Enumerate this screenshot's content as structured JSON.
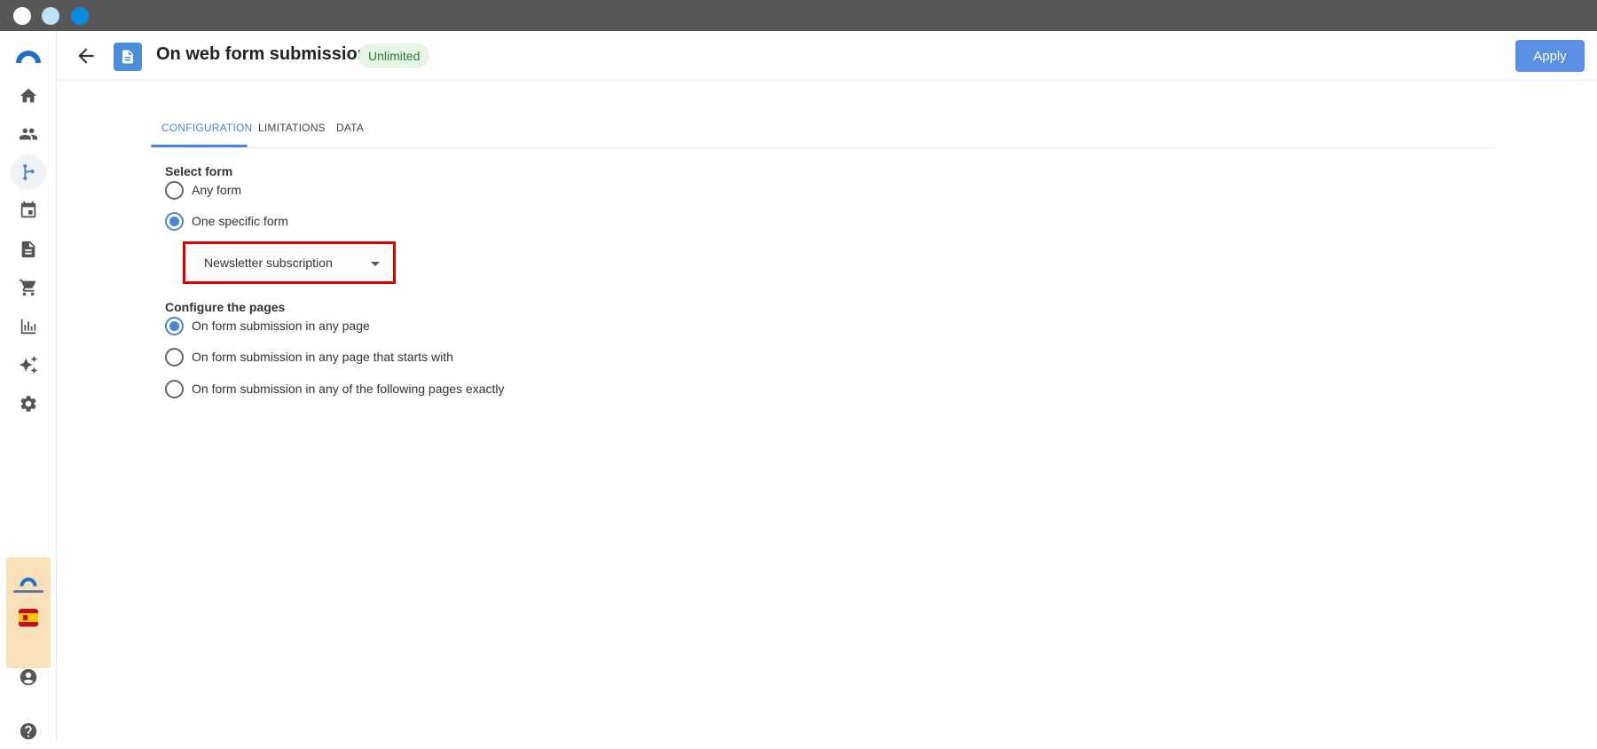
{
  "header": {
    "title": "On web form submission",
    "status_badge": "Unlimited",
    "apply_label": "Apply"
  },
  "tabs": [
    {
      "label": "CONFIGURATION",
      "active": true
    },
    {
      "label": "LIMITATIONS",
      "active": false
    },
    {
      "label": "DATA",
      "active": false
    }
  ],
  "select_form": {
    "label": "Select form",
    "options": [
      {
        "label": "Any form",
        "checked": false
      },
      {
        "label": "One specific form",
        "checked": true
      }
    ],
    "dropdown_value": "Newsletter subscription"
  },
  "configure_pages": {
    "label": "Configure the pages",
    "options": [
      {
        "label": "On form submission in any page",
        "checked": true
      },
      {
        "label": "On form submission in any page that starts with",
        "checked": false
      },
      {
        "label": "On form submission in any of the following pages exactly",
        "checked": false
      }
    ]
  },
  "sidebar": {
    "items": [
      "home-icon",
      "contacts-icon",
      "automation-icon",
      "calendar-icon",
      "document-icon",
      "cart-icon",
      "reports-icon",
      "ai-sparkle-icon",
      "settings-icon"
    ],
    "active_item": "automation-icon",
    "bottom": [
      "account-icon",
      "help-icon"
    ]
  },
  "colors": {
    "accent": "#4a86d8",
    "apply_button": "#5b8fe6",
    "highlight_border": "#e00000",
    "badge_bg": "#e6f5e6",
    "badge_text": "#2f7d32",
    "titlebar": "#575757"
  }
}
